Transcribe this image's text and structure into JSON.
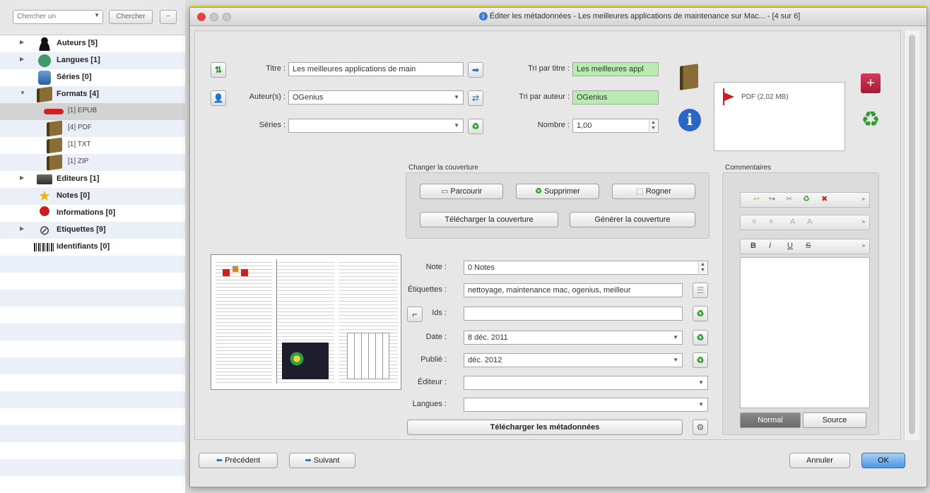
{
  "sidebar": {
    "search_placeholder": "Chercher un",
    "search_button": "Chercher",
    "items": [
      {
        "label": "Auteurs [5]",
        "icon": "person-icon"
      },
      {
        "label": "Langues [1]",
        "icon": "globe-icon"
      },
      {
        "label": "Séries [0]",
        "icon": "series-icon"
      },
      {
        "label": "Formats [4]",
        "icon": "book-icon"
      },
      {
        "label": "[1] EPUB",
        "icon": "epub-icon"
      },
      {
        "label": "[4] PDF",
        "icon": "book-icon"
      },
      {
        "label": "[1] TXT",
        "icon": "book-icon"
      },
      {
        "label": "[1] ZIP",
        "icon": "book-icon"
      },
      {
        "label": "Editeurs [1]",
        "icon": "publisher-icon"
      },
      {
        "label": "Notes [0]",
        "icon": "star-icon"
      },
      {
        "label": "Informations [0]",
        "icon": "info-icon"
      },
      {
        "label": "Etiquettes [9]",
        "icon": "tag-icon"
      },
      {
        "label": "Identifiants [0]",
        "icon": "barcode-icon"
      }
    ]
  },
  "dialog": {
    "title": "Éditer les métadonnées - Les meilleures applications de maintenance sur Mac... - [4 sur 6]",
    "labels": {
      "title": "Titre :",
      "sort_title": "Tri par titre :",
      "authors": "Auteur(s) :",
      "sort_author": "Tri par auteur :",
      "series": "Séries :",
      "number": "Nombre :",
      "rating": "Note :",
      "tags": "Étiquettes :",
      "ids": "Ids :",
      "date": "Date :",
      "published": "Publié :",
      "publisher": "Éditeur :",
      "languages": "Langues :"
    },
    "values": {
      "title": "Les meilleures applications de main",
      "sort_title": "Les meilleures appl",
      "authors": "OGenius",
      "sort_author": "OGenius",
      "series": "",
      "number": "1,00",
      "rating": "0 Notes",
      "tags": "nettoyage, maintenance mac, ogenius, meilleur",
      "ids": "",
      "date": "8 déc. 2011",
      "published": "déc. 2012",
      "publisher": "",
      "languages": ""
    },
    "formats": [
      {
        "label": "PDF (2,02 MB)"
      }
    ],
    "cover": {
      "group_title": "Changer la couverture",
      "browse": "Parcourir",
      "remove": "Supprimer",
      "trim": "Rogner",
      "download": "Télécharger la couverture",
      "generate": "Générer la couverture"
    },
    "comments": {
      "group_title": "Commentaires",
      "tab_normal": "Normal",
      "tab_source": "Source"
    },
    "download_metadata": "Télécharger les métadonnées",
    "nav": {
      "previous": "Précédent",
      "next": "Suivant",
      "cancel": "Annuler",
      "ok": "OK"
    }
  }
}
